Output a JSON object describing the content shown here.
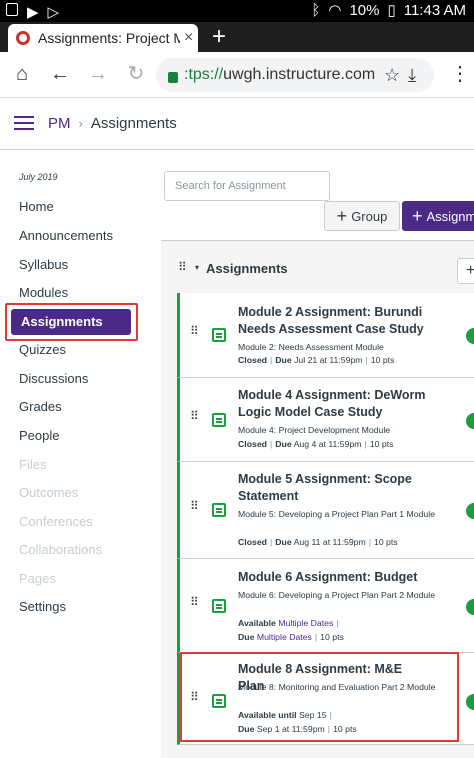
{
  "status": {
    "battery": "10%",
    "time": "11:43 AM"
  },
  "browser": {
    "tab_title": "Assignments: Project Me",
    "tab_close": "×",
    "new_tab": "+",
    "url_prefix": ":tps://",
    "url_host": "uwgh.instructure.com"
  },
  "header": {
    "course": "PM",
    "separator": "›",
    "current": "Assignments"
  },
  "sidebar": {
    "term": "July 2019",
    "items": [
      {
        "label": "Home",
        "enabled": true
      },
      {
        "label": "Announcements",
        "enabled": true
      },
      {
        "label": "Syllabus",
        "enabled": true
      },
      {
        "label": "Modules",
        "enabled": true
      },
      {
        "label": "Assignments",
        "enabled": true,
        "active": true
      },
      {
        "label": "Quizzes",
        "enabled": true
      },
      {
        "label": "Discussions",
        "enabled": true
      },
      {
        "label": "Grades",
        "enabled": true
      },
      {
        "label": "People",
        "enabled": true
      },
      {
        "label": "Files",
        "enabled": false
      },
      {
        "label": "Outcomes",
        "enabled": false
      },
      {
        "label": "Conferences",
        "enabled": false
      },
      {
        "label": "Collaborations",
        "enabled": false
      },
      {
        "label": "Pages",
        "enabled": false
      },
      {
        "label": "Settings",
        "enabled": true
      }
    ]
  },
  "toolbar": {
    "search_placeholder": "Search for Assignment",
    "group_label": "Group",
    "assignment_label": "Assignm",
    "plus": "+"
  },
  "group": {
    "title": "Assignments",
    "caret": "▾",
    "add": "+"
  },
  "assignments": [
    {
      "title": "Module 2 Assignment: Burundi Needs Assessment Case Study",
      "module": "Module 2: Needs Assessment Module",
      "status": "Closed",
      "due_label": "Due",
      "due": "Jul 21 at 11:59pm",
      "points": "10 pts"
    },
    {
      "title": "Module 4 Assignment: DeWorm Logic Model Case Study",
      "module": "Module 4: Project Development Module",
      "status": "Closed",
      "due_label": "Due",
      "due": "Aug 4 at 11:59pm",
      "points": "10 pts"
    },
    {
      "title": "Module 5 Assignment: Scope Statement",
      "module": "Module 5: Developing a Project Plan Part 1 Module",
      "status": "Closed",
      "due_label": "Due",
      "due": "Aug 11 at 11:59pm",
      "points": "10 pts"
    },
    {
      "title": "Module 6 Assignment: Budget",
      "module": "Module 6: Developing a Project Plan Part 2 Module",
      "available_label": "Available",
      "available": "Multiple Dates",
      "due_label": "Due",
      "due": "Multiple Dates",
      "points": "10 pts"
    },
    {
      "title": "Module 8 Assignment: M&E Plan",
      "module": "Module 8: Monitoring and Evaluation Part 2 Module",
      "available_label": "Available until",
      "available": "Sep 15",
      "due_label": "Due",
      "due": "Sep 1 at 11:59pm",
      "points": "10 pts"
    }
  ],
  "colors": {
    "brand": "#4b2a87",
    "published": "#1b9e3e",
    "highlight": "#e53935"
  },
  "icons": [
    "home-icon",
    "back-icon",
    "forward-icon",
    "reload-icon",
    "lock-icon",
    "star-icon",
    "download-icon",
    "menu-icon",
    "hamburger-icon",
    "drag-handle-icon",
    "assignment-icon",
    "published-icon"
  ]
}
